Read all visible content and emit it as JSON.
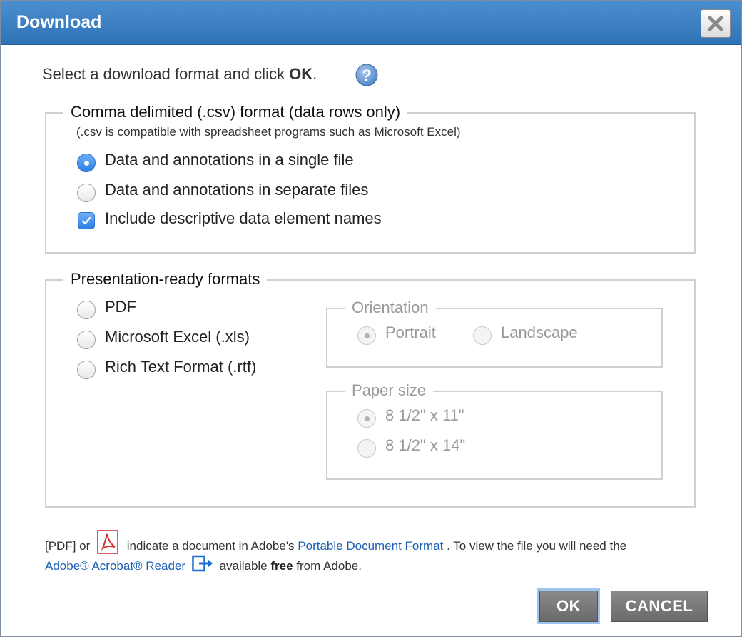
{
  "dialog": {
    "title": "Download",
    "close_icon": "close-x-icon"
  },
  "intro": {
    "text": "Select a download format and click ",
    "bold": "OK",
    "end": ".",
    "help_icon": "help-question-icon"
  },
  "csv_section": {
    "legend": "Comma delimited (.csv) format (data rows only)",
    "note": "(.csv is compatible with spreadsheet programs such as Microsoft Excel)",
    "options": [
      {
        "label": "Data and annotations in a single file",
        "selected": true
      },
      {
        "label": "Data and annotations in separate files",
        "selected": false
      }
    ],
    "checkbox": {
      "label": "Include descriptive data element names",
      "checked": true
    }
  },
  "presentation_section": {
    "legend": "Presentation-ready formats",
    "options": [
      {
        "label": "PDF",
        "selected": false
      },
      {
        "label": "Microsoft Excel (.xls)",
        "selected": false
      },
      {
        "label": "Rich Text Format (.rtf)",
        "selected": false
      }
    ],
    "orientation": {
      "legend": "Orientation",
      "options": [
        {
          "label": "Portrait",
          "selected": true,
          "disabled": true
        },
        {
          "label": "Landscape",
          "selected": false,
          "disabled": true
        }
      ]
    },
    "paper_size": {
      "legend": "Paper size",
      "options": [
        {
          "label": "8 1/2\" x 11\"",
          "selected": true,
          "disabled": true
        },
        {
          "label": "8 1/2\" x 14\"",
          "selected": false,
          "disabled": true
        }
      ]
    }
  },
  "footer": {
    "line1_a": "[PDF] or",
    "line1_b": "indicate a document in Adobe's",
    "pdf_link": "Portable Document Format",
    "line1_c": ". To view the file you will need the",
    "reader_link": "Adobe® Acrobat® Reader",
    "line2_a": "available",
    "line2_bold": "free",
    "line2_b": "from Adobe.",
    "pdf_icon": "pdf-file-icon",
    "external_icon": "external-link-icon"
  },
  "buttons": {
    "ok": "OK",
    "cancel": "CANCEL"
  },
  "colors": {
    "titlebar": "#3a80c5",
    "accent": "#2b7fe6",
    "link": "#1b5fb3",
    "button": "#7a7a7a"
  }
}
